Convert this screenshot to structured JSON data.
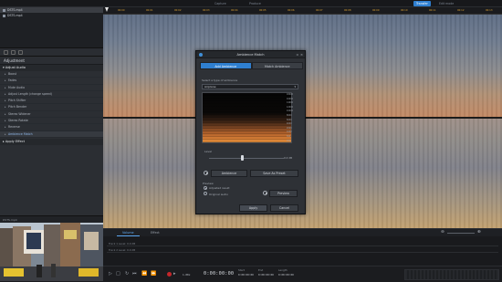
{
  "app": {
    "top_tabs": [
      {
        "label": "Capture"
      },
      {
        "label": "Produce"
      },
      {
        "label": "Transfer"
      },
      {
        "label": "Edit mode"
      }
    ]
  },
  "media": {
    "items": [
      {
        "label": "DSTS.mp4",
        "selected": true
      },
      {
        "label": "DSTS.mp4",
        "selected": false
      }
    ]
  },
  "adjustment": {
    "title": "Adjustment",
    "group_label": "Adjust Audio",
    "items": [
      {
        "label": "Boost"
      },
      {
        "label": "Fades"
      },
      {
        "label": "Mute Audio"
      },
      {
        "label": "Adjust Length (change speed)"
      },
      {
        "label": "Pitch Shifter"
      },
      {
        "label": "Pitch Bender"
      },
      {
        "label": "Stereo Widener"
      },
      {
        "label": "Stereo Rotate"
      },
      {
        "label": "Reverse"
      },
      {
        "label": "Ambience Match",
        "selected": true
      }
    ],
    "apply_group_label": "Apply Effect"
  },
  "preview_panel": {
    "label": "DSTS.mp4"
  },
  "ruler": {
    "ticks": [
      "00:00",
      "00:01",
      "00:02",
      "00:03",
      "00:04",
      "00:05",
      "00:06",
      "00:07",
      "00:08",
      "00:09",
      "00:10",
      "00:11",
      "00:12",
      "00:13"
    ]
  },
  "dialog": {
    "title": "Ambience Match",
    "tabs": [
      {
        "label": "Add Ambience",
        "active": true
      },
      {
        "label": "Match Ambience",
        "active": false
      }
    ],
    "select_label": "Select a type of ambience",
    "select_value": "Airplane",
    "frequencies": [
      "18000",
      "16000",
      "14000",
      "12000",
      "10000",
      "8000",
      "6000",
      "4000",
      "2000",
      "1000",
      "500",
      "250"
    ],
    "level_label": "Level",
    "level_value": "0.0 dB",
    "ambience_button": "Ambience",
    "save_preset_button": "Save As Preset",
    "preview_label": "Preview",
    "radio_adjusted": "Adjusted result",
    "radio_original": "Original audio",
    "preview_button": "Preview",
    "apply_button": "Apply",
    "cancel_button": "Cancel"
  },
  "subtabs": [
    {
      "label": "Volume",
      "active": true
    },
    {
      "label": "Effect",
      "active": false
    }
  ],
  "tracks": [
    {
      "label": "Track 1 Level: 0.0 dB"
    },
    {
      "label": "Track 2 Level: 0.0 dB"
    }
  ],
  "transport": {
    "timecode": "0:00:00:00",
    "start_label": "Start",
    "start_value": "0:00:00:00",
    "end_label": "End",
    "end_value": "0:00:00:00",
    "length_label": "Length",
    "length_value": "0:00:00:00",
    "speed_label": "1.00x"
  },
  "colors": {
    "accent": "#2f7fd0",
    "record": "#c4262a",
    "ruler_text": "#d8a034"
  }
}
